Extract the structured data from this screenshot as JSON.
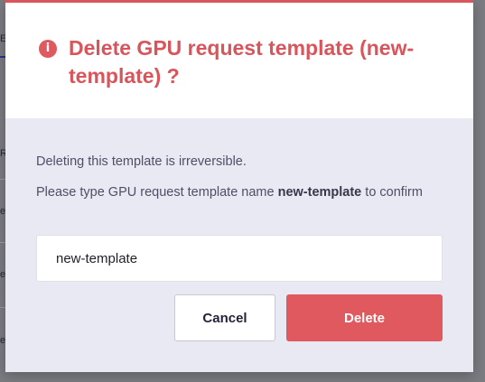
{
  "background": {
    "glyphs": [
      "E",
      "R",
      "e",
      "e",
      "e"
    ]
  },
  "dialog": {
    "title": "Delete GPU request template (new-template) ?",
    "icon": "alert-info-icon",
    "message": "Deleting this template is irreversible.",
    "confirm_prefix": "Please type GPU request template name ",
    "confirm_name": "new-template",
    "confirm_suffix": " to confirm",
    "input_value": "new-template",
    "cancel_label": "Cancel",
    "delete_label": "Delete"
  },
  "colors": {
    "accent": "#d9555c",
    "delete_button": "#e0595e",
    "dialog_body": "#e9e9f3"
  }
}
